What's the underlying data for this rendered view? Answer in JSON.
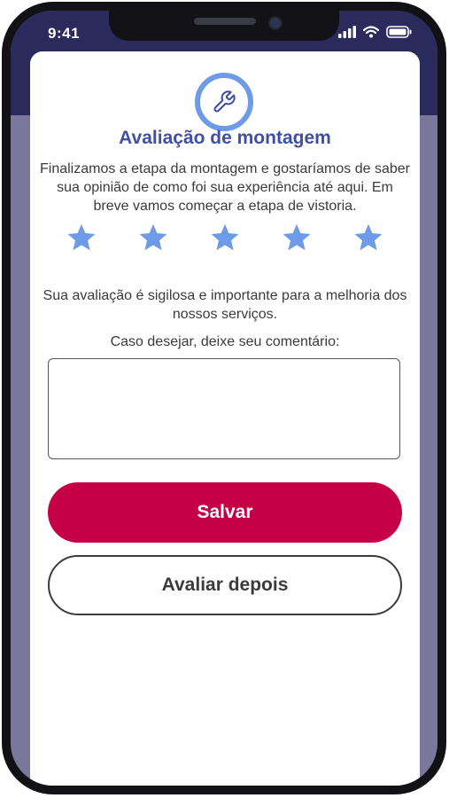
{
  "status_bar": {
    "time": "9:41"
  },
  "header": {
    "icon": "wrench-icon",
    "title": "Avaliação de montagem"
  },
  "description": "Finalizamos a etapa da montagem e gostaríamos de saber sua opinião de como foi sua experiência até aqui. Em breve vamos começar a etapa de vistoria.",
  "rating": {
    "max": 5,
    "selected": 0,
    "star_color": "#6e9be8"
  },
  "privacy_note": "Sua avaliação é sigilosa e importante para a melhoria dos nossos serviços.",
  "comment": {
    "label": "Caso desejar, deixe seu comentário:",
    "value": ""
  },
  "actions": {
    "save_label": "Salvar",
    "later_label": "Avaliar depois"
  },
  "colors": {
    "primary": "#c50045",
    "title": "#3f4fa3",
    "header_bg": "#2a2b5c",
    "side_bg": "#7b779c"
  }
}
